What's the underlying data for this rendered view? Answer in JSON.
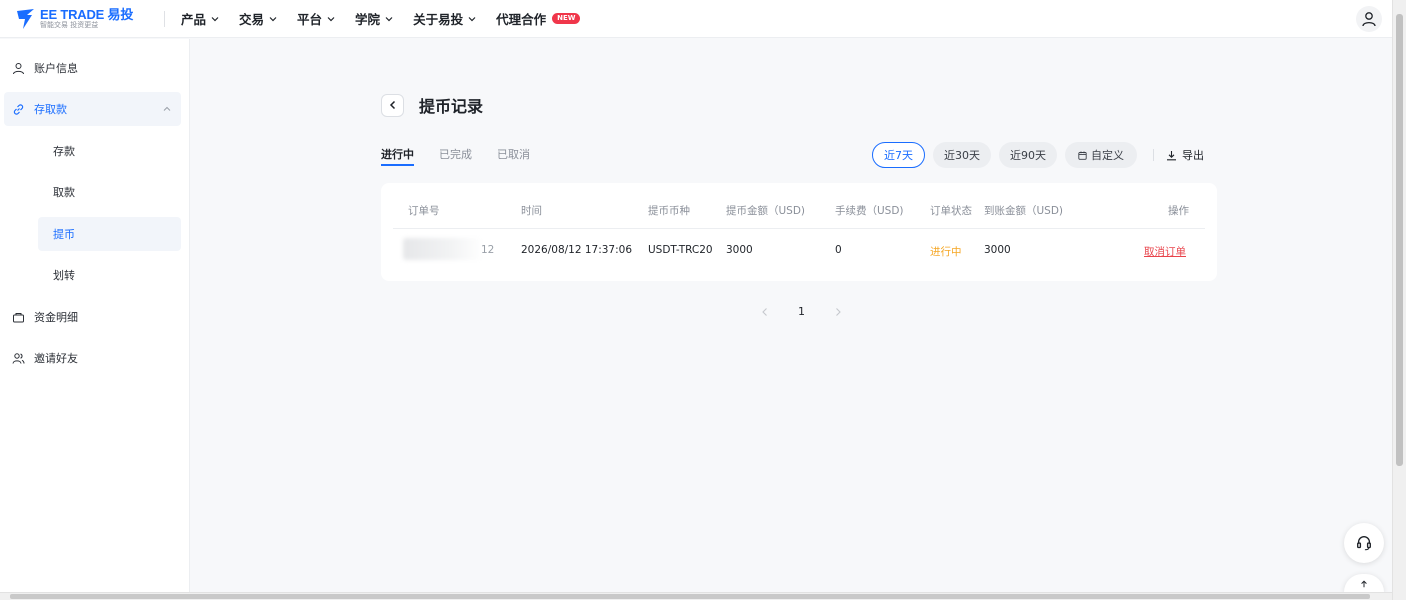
{
  "brand": {
    "name": "EE TRADE 易投",
    "tagline": "智能交易 投资更益",
    "color": "#1a6dff"
  },
  "nav": [
    {
      "label": "产品",
      "dropdown": true
    },
    {
      "label": "交易",
      "dropdown": true
    },
    {
      "label": "平台",
      "dropdown": true
    },
    {
      "label": "学院",
      "dropdown": true
    },
    {
      "label": "关于易投",
      "dropdown": true
    },
    {
      "label": "代理合作",
      "badge": "NEW"
    }
  ],
  "sidebar": {
    "items": [
      {
        "label": "账户信息",
        "icon": "user-icon"
      },
      {
        "label": "存取款",
        "icon": "link-icon",
        "expanded": true,
        "children": [
          {
            "label": "存款"
          },
          {
            "label": "取款"
          },
          {
            "label": "提币",
            "active": true
          },
          {
            "label": "划转"
          }
        ]
      },
      {
        "label": "资金明细",
        "icon": "wallet-icon"
      },
      {
        "label": "邀请好友",
        "icon": "users-icon"
      }
    ]
  },
  "page": {
    "title": "提币记录"
  },
  "tabs": [
    {
      "label": "进行中",
      "active": true
    },
    {
      "label": "已完成"
    },
    {
      "label": "已取消"
    }
  ],
  "filters": [
    {
      "label": "近7天",
      "active": true
    },
    {
      "label": "近30天"
    },
    {
      "label": "近90天"
    },
    {
      "label": "自定义",
      "icon": "calendar-icon"
    }
  ],
  "export_label": "导出",
  "table": {
    "columns": [
      "订单号",
      "时间",
      "提币币种",
      "提币金额（USD)",
      "手续费（USD)",
      "订单状态",
      "到账金额（USD)",
      "操作"
    ],
    "rows": [
      {
        "order_id_visible": "12",
        "time": "2026/08/12 17:37:06",
        "currency": "USDT-TRC20",
        "amount": "3000",
        "fee": "0",
        "status": "进行中",
        "received": "3000",
        "action": "取消订单"
      }
    ]
  },
  "pagination": {
    "current": "1"
  },
  "colors": {
    "accent": "#1a6dff",
    "pending": "#f5a623",
    "danger": "#e8434b",
    "new_badge": "#f0364a"
  }
}
